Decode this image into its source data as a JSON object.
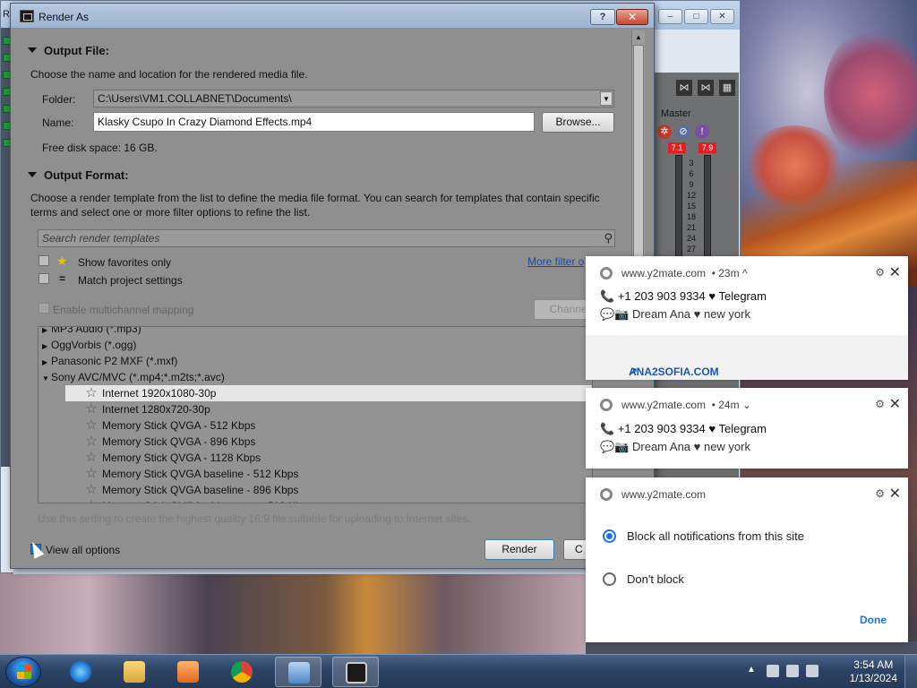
{
  "background_window": {
    "title": "Render *",
    "mixer": {
      "master_label": "Master",
      "peak_left": "7.1",
      "peak_right": "7.9",
      "scale": [
        "3",
        "6",
        "9",
        "12",
        "15",
        "18",
        "21",
        "24",
        "27"
      ]
    }
  },
  "dialog": {
    "title": "Render As",
    "help_label": "?",
    "close_label": "✕",
    "output_file": {
      "heading": "Output File:",
      "description": "Choose the name and location for the rendered media file.",
      "folder_label": "Folder:",
      "folder_value": "C:\\Users\\VM1.COLLABNET\\Documents\\",
      "name_label": "Name:",
      "name_value": "Klasky Csupo In Crazy Diamond Effects.mp4",
      "browse_label": "Browse...",
      "free_space": "Free disk space: 16 GB."
    },
    "output_format": {
      "heading": "Output Format:",
      "description": "Choose a render template from the list to define the media file format. You can search for templates that contain specific terms and select one or more filter options to refine the list.",
      "search_placeholder": "Search render templates",
      "show_favorites": "Show favorites only",
      "match_project": "Match project settings",
      "more_filter": "More filter o",
      "multichannel": "Enable multichannel mapping",
      "channels_button": "Channel",
      "tree": [
        {
          "label": "MP3 Audio (*.mp3)",
          "level": 0,
          "expanded": false
        },
        {
          "label": "OggVorbis (*.ogg)",
          "level": 0,
          "expanded": false
        },
        {
          "label": "Panasonic P2 MXF (*.mxf)",
          "level": 0,
          "expanded": false
        },
        {
          "label": "Sony AVC/MVC (*.mp4;*.m2ts;*.avc)",
          "level": 0,
          "expanded": true
        },
        {
          "label": "Internet 1920x1080-30p",
          "level": 1,
          "selected": true
        },
        {
          "label": "Internet 1280x720-30p",
          "level": 1
        },
        {
          "label": "Memory Stick QVGA - 512 Kbps",
          "level": 1
        },
        {
          "label": "Memory Stick QVGA - 896 Kbps",
          "level": 1
        },
        {
          "label": "Memory Stick QVGA - 1128 Kbps",
          "level": 1
        },
        {
          "label": "Memory Stick QVGA baseline - 512 Kbps",
          "level": 1
        },
        {
          "label": "Memory Stick QVGA baseline - 896 Kbps",
          "level": 1
        },
        {
          "label": "Memory Stick QVGA widescreen - 512 Kbps",
          "level": 1
        }
      ],
      "template_hint": "Use this setting to create the highest quality 16:9 file suitable for uploading to Internet sites."
    },
    "view_all_options": "View all options",
    "render_label": "Render",
    "cancel_label": "C"
  },
  "notifications": [
    {
      "site": "www.y2mate.com",
      "age": "• 23m ^",
      "line1": "+1 203 903 9334 ♥ Telegram",
      "line2": "Dream Ana ♥ new york",
      "link": "ANA2SOFIA.COM"
    },
    {
      "site": "www.y2mate.com",
      "age": "• 24m ⌄",
      "line1": "+1 203 903 9334 ♥ Telegram",
      "line2": "Dream Ana ♥ new york"
    }
  ],
  "permission_popup": {
    "site": "www.y2mate.com",
    "option_block": "Block all notifications from this site",
    "option_dont_block": "Don't block",
    "done_label": "Done"
  },
  "taskbar": {
    "time": "3:54 AM",
    "date": "1/13/2024"
  },
  "colors": {
    "accent_blue": "#1a73e8",
    "link_blue": "#1a56b8",
    "dialog_gray": "#8f8f8f",
    "close_red": "#c5472f",
    "peak_red": "#e02020"
  }
}
